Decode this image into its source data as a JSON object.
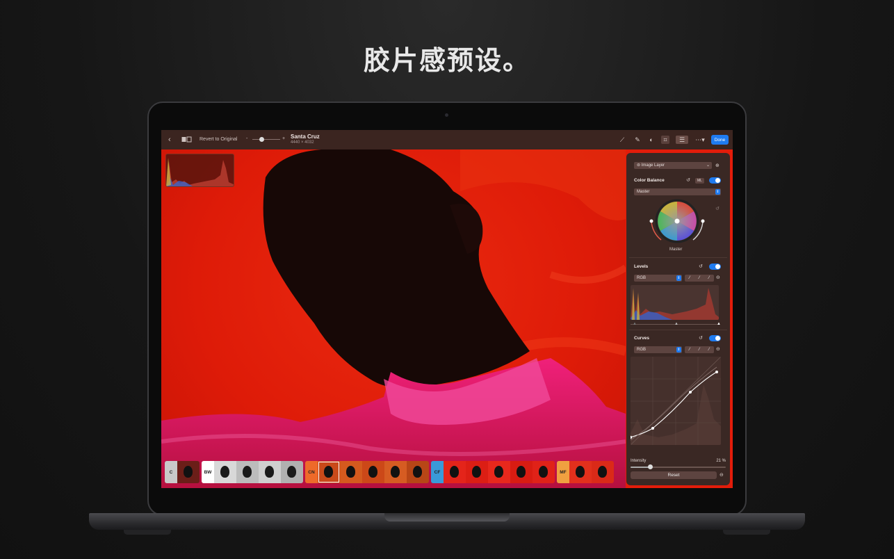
{
  "headline": "胶片感预设。",
  "toolbar": {
    "revert_label": "Revert to Original",
    "zoom_minus": "-",
    "zoom_plus": "+",
    "title": "Santa Cruz",
    "dimensions": "4440 × 4032",
    "done_label": "Done"
  },
  "panel": {
    "layer_select": "Image Layer",
    "color_balance": {
      "title": "Color Balance",
      "ml_label": "ML",
      "enabled": true,
      "range_select": "Master",
      "wheel_label": "Master"
    },
    "levels": {
      "title": "Levels",
      "enabled": true,
      "channel_select": "RGB"
    },
    "curves": {
      "title": "Curves",
      "enabled": true,
      "channel_select": "RGB"
    },
    "intensity": {
      "label": "Intensity",
      "value": 21,
      "value_text": "21 %"
    },
    "reset_label": "Reset"
  },
  "filmstrip": {
    "groups": [
      {
        "label": "C",
        "color": "#c9c9c9",
        "count": 1
      },
      {
        "label": "BW",
        "color": "#ffffff",
        "count": 4
      },
      {
        "label": "CN",
        "color": "#ee6a2a",
        "count": 5,
        "selected_index": 0
      },
      {
        "label": "CF",
        "color": "#3a9ad9",
        "count": 5
      },
      {
        "label": "MF",
        "color": "#f0a040",
        "count": 2
      }
    ]
  },
  "colors": {
    "accent": "#1f7bf0",
    "photo_red": "#e21c0a",
    "panel_bg": "#3a2824"
  }
}
